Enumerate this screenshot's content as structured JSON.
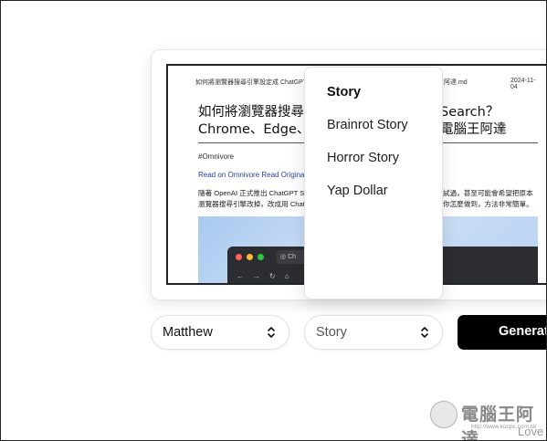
{
  "document": {
    "header_left": "如何將瀏覽器搜尋引擎設定成 ChatGPT S",
    "header_right_filename": "阿達.md",
    "header_date": "2024-11-04",
    "title_line1": "如何將瀏覽器搜尋",
    "title_line1_end": "Search？",
    "title_line2": "Chrome、Edge、",
    "title_line2_end": "電腦王阿達",
    "tag": "#Omnivore",
    "links": "Read on Omnivore Read Original",
    "body_line1_start": "隨著 OpenAI 正式推出 ChatGPT Se",
    "body_line1_end": "試過，甚至可能會希望把原本",
    "body_line2_start": "瀏覽器搜尋引擎改掉，改成用 Chat",
    "body_line2_end": "你怎麼做到，方法非常簡單。",
    "image": {
      "tab_label": "Ch",
      "nav_icons": "←→↻⌂"
    }
  },
  "story_menu": {
    "items": [
      {
        "label": "Story",
        "selected": true
      },
      {
        "label": "Brainrot Story",
        "selected": false
      },
      {
        "label": "Horror Story",
        "selected": false
      },
      {
        "label": "Yap Dollar",
        "selected": false
      }
    ]
  },
  "controls": {
    "voice_select": "Matthew",
    "style_select": "Story",
    "generate_label": "Generate"
  },
  "watermark": {
    "brand": "電腦王阿達",
    "url": "http://www.kocpc.com.tw",
    "love": "Love"
  },
  "colors": {
    "link": "#2b3fb0",
    "button_bg": "#000000",
    "button_text": "#ffffff"
  }
}
